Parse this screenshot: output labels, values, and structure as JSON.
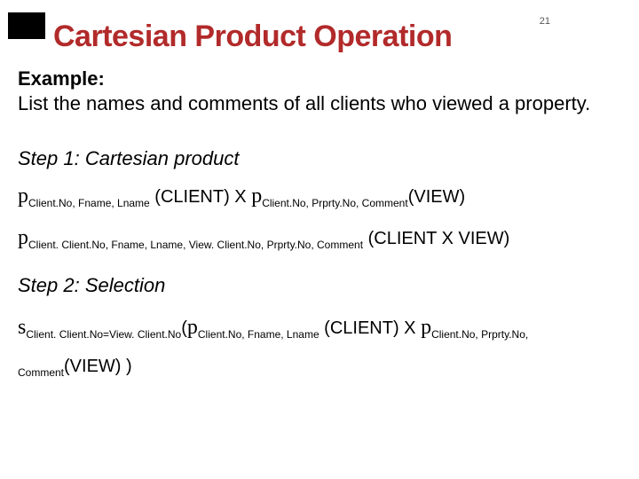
{
  "page_number": "21",
  "title": "Cartesian Product Operation",
  "example_label": "Example:",
  "prompt": "List the names and comments of all clients who  viewed a property.",
  "step1": {
    "heading": "Step 1: Cartesian product",
    "line1": {
      "pi": "p",
      "sub1": "Client.No, Fname, Lname",
      "rel1": " (CLIENT) X ",
      "sub2": "Client.No, Prprty.No, Comment",
      "rel2": "(VIEW)"
    },
    "line2": {
      "pi": "p",
      "sub": "Client. Client.No, Fname, Lname, View. Client.No, Prprty.No, Comment",
      "rel": " (CLIENT X VIEW)"
    }
  },
  "step2": {
    "heading": "Step 2: Selection",
    "line": {
      "sigma": "s",
      "sub1": "Client. Client.No=View. Client.No",
      "open": "(",
      "pi": "p",
      "sub2": "Client.No,  Fname,  Lname",
      "mid": " (CLIENT)  X  ",
      "sub3": "Client.No,  Prprty.No,",
      "sub4": "Comment",
      "close": "(VIEW) )"
    }
  }
}
